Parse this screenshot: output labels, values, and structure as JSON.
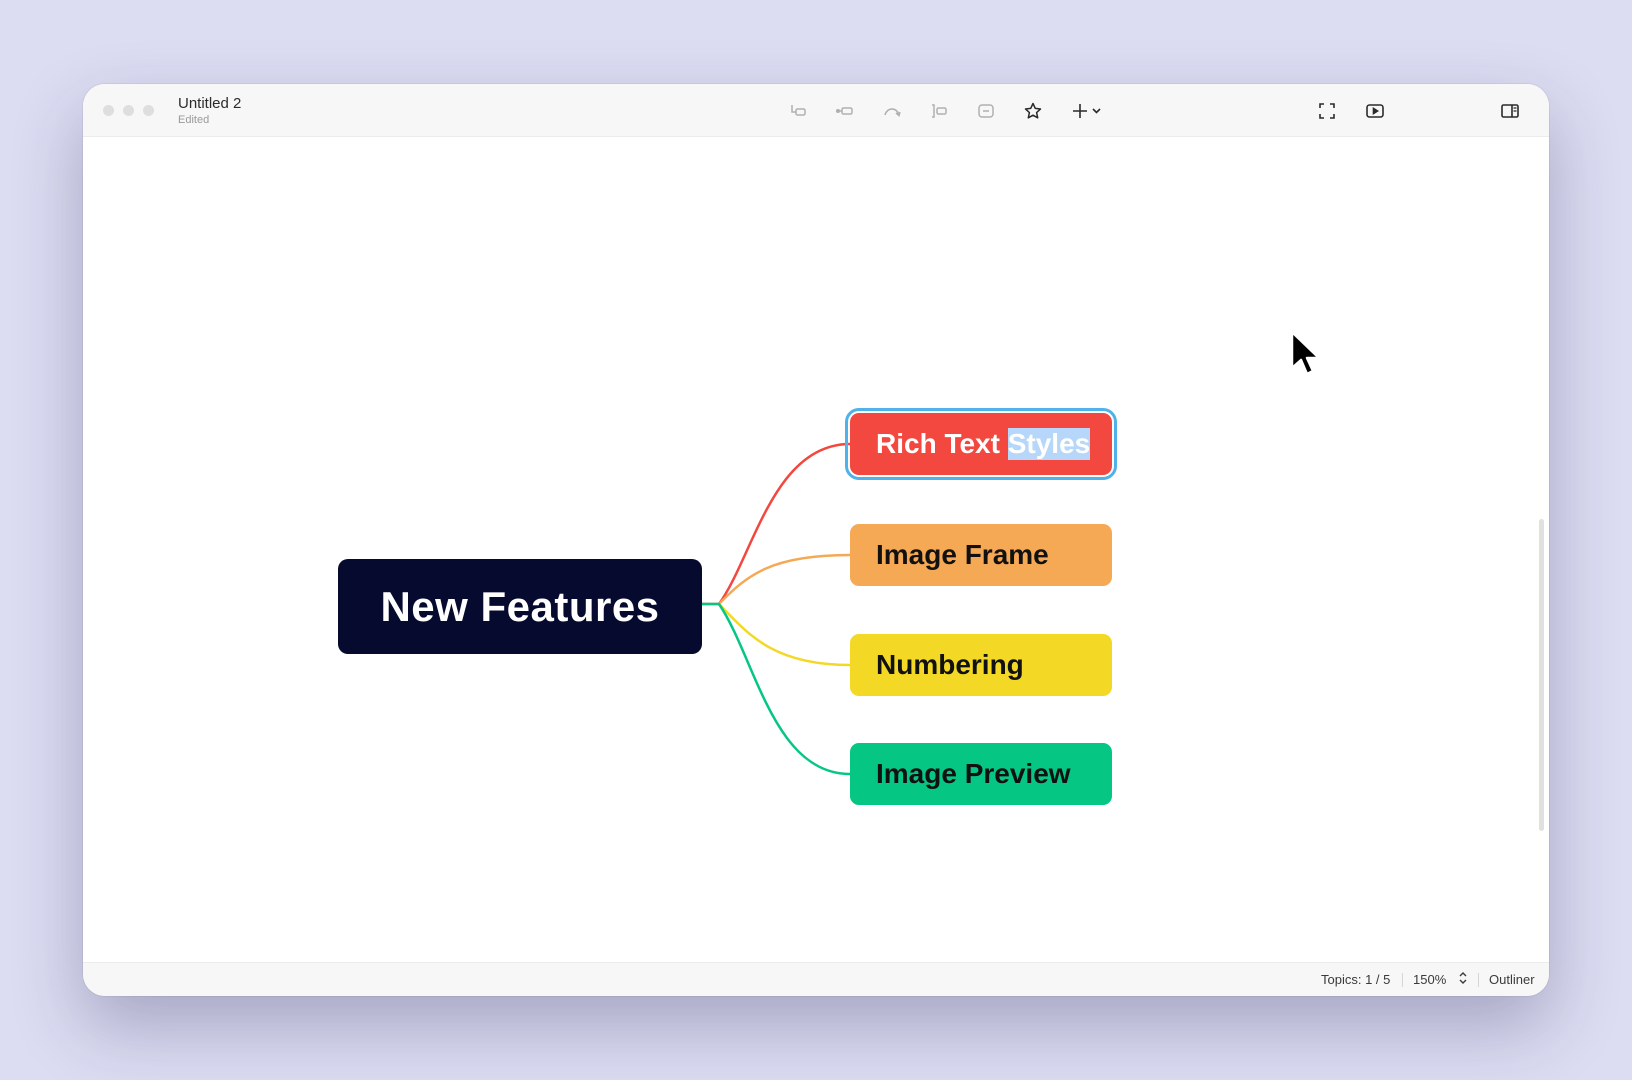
{
  "window": {
    "title": "Untitled 2",
    "subtitle": "Edited"
  },
  "toolbar": {
    "icons": [
      "topic-icon",
      "subtopic-icon",
      "relationship-icon",
      "boundary-icon",
      "summary-icon",
      "star-icon",
      "add-icon",
      "fullscreen-icon",
      "play-icon",
      "sidebar-icon"
    ]
  },
  "mindmap": {
    "root": "New Features",
    "topics": [
      {
        "label_plain": "Rich Text ",
        "label_selected": "Styles",
        "color": "#f2483f"
      },
      {
        "label": "Image Frame",
        "color": "#f5a955"
      },
      {
        "label": "Numbering",
        "color": "#f3d925"
      },
      {
        "label": "Image Preview",
        "color": "#06c683"
      }
    ]
  },
  "status": {
    "topics": "Topics: 1 / 5",
    "zoom": "150%",
    "view": "Outliner"
  },
  "colors": {
    "root_bg": "#050a2e",
    "selection": "#4fb3ea",
    "text_highlight": "#b6d7f9"
  }
}
